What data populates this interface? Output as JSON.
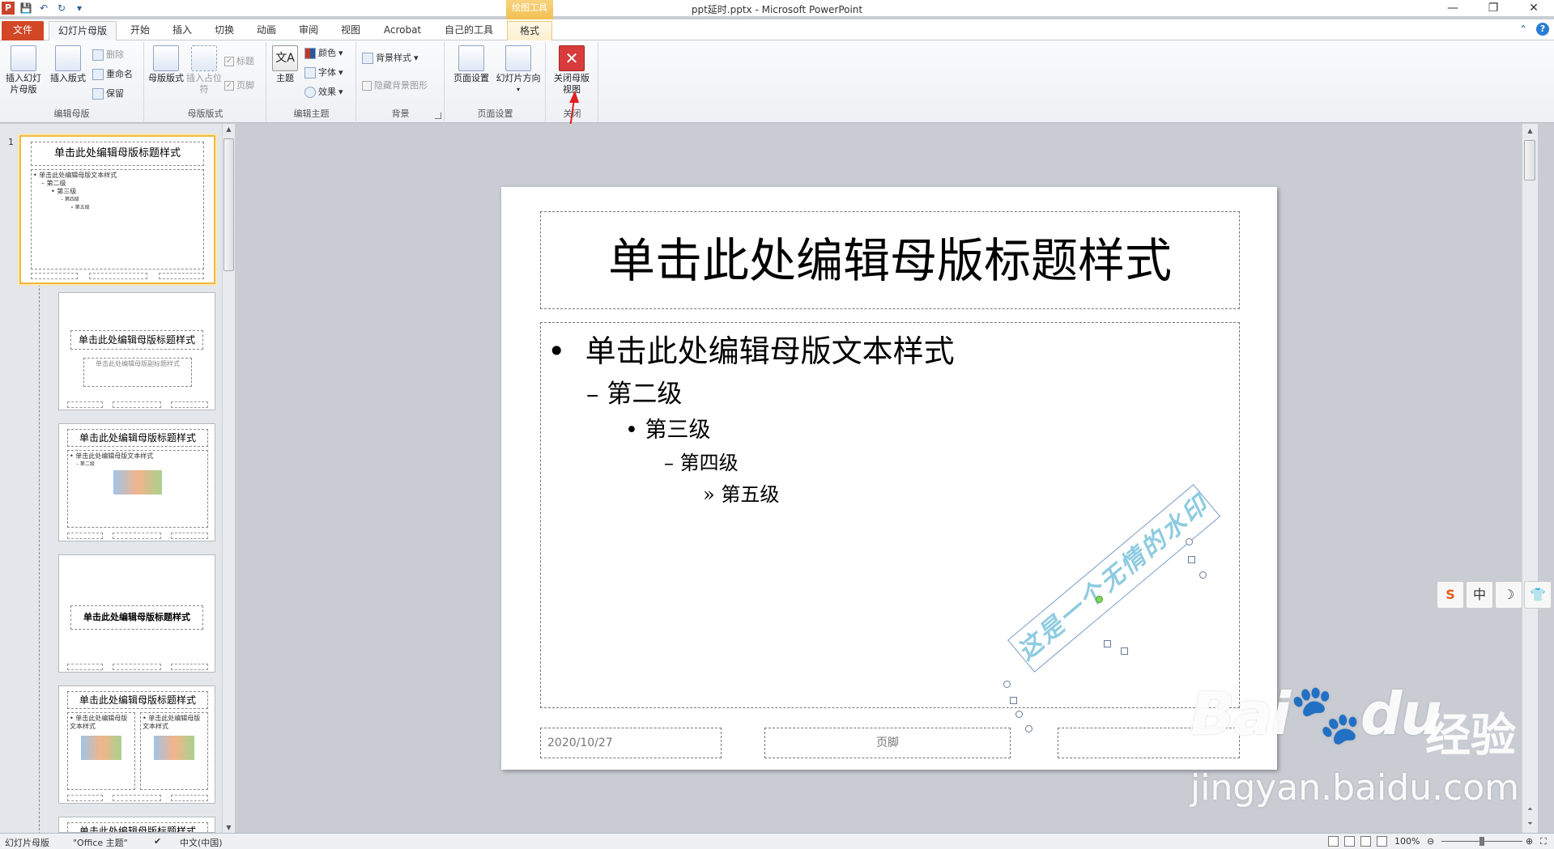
{
  "window": {
    "title": "ppt延时.pptx - Microsoft PowerPoint",
    "app_logo": "P",
    "contextual_group": "绘图工具"
  },
  "tabs": [
    {
      "label": "文件",
      "kind": "file"
    },
    {
      "label": "幻灯片母版",
      "kind": "active"
    },
    {
      "label": "开始"
    },
    {
      "label": "插入"
    },
    {
      "label": "切换"
    },
    {
      "label": "动画"
    },
    {
      "label": "审阅"
    },
    {
      "label": "视图"
    },
    {
      "label": "Acrobat"
    },
    {
      "label": "自己的工具"
    },
    {
      "label": "格式",
      "kind": "ctx"
    }
  ],
  "ribbon": {
    "edit_master": {
      "label": "编辑母版",
      "insert_slide_master": "插入幻灯片母版",
      "insert_layout": "插入版式",
      "delete": "删除",
      "rename": "重命名",
      "preserve": "保留"
    },
    "master_layout": {
      "label": "母版版式",
      "master_layout_btn": "母版版式",
      "insert_placeholder": "插入占位符",
      "title_chk": "标题",
      "footer_chk": "页脚"
    },
    "edit_theme": {
      "label": "编辑主题",
      "themes": "主题",
      "colors": "颜色",
      "fonts": "字体",
      "effects": "效果"
    },
    "background": {
      "label": "背景",
      "bg_styles": "背景样式",
      "hide_bg": "隐藏背景图形"
    },
    "page_setup": {
      "label": "页面设置",
      "page_setup_btn": "页面设置",
      "orientation": "幻灯片方向"
    },
    "close": {
      "label": "关闭",
      "close_master": "关闭母版视图"
    }
  },
  "thumbnails": {
    "first_number": "1",
    "master_title": "单击此处编辑母版标题样式",
    "master_text": "单击此处编辑母版文本样式",
    "lvl2": "第二级",
    "lvl3": "第三级",
    "lvl4": "第四级",
    "lvl5": "第五级",
    "subtitle": "单击此处编辑母版副标题样式"
  },
  "slide": {
    "title": "单击此处编辑母版标题样式",
    "levels": [
      {
        "bullet": "•",
        "text": "单击此处编辑母版文本样式"
      },
      {
        "bullet": "–",
        "text": "第二级"
      },
      {
        "bullet": "•",
        "text": "第三级"
      },
      {
        "bullet": "–",
        "text": "第四级"
      },
      {
        "bullet": "»",
        "text": "第五级"
      }
    ],
    "date": "2020/10/27",
    "footer": "页脚",
    "watermark": "这是一个无情的水印"
  },
  "ime": {
    "logo": "S",
    "mode": "中",
    "moon": "☽",
    "skin": "👕"
  },
  "status": {
    "view_name": "幻灯片母版",
    "theme": "\"Office 主题\"",
    "language": "中文(中国)",
    "zoom": "100%",
    "zoom_level": 0.5
  },
  "overlay": {
    "brand": "Bai",
    "brand2": "du",
    "cn": "经验",
    "url": "jingyan.baidu.com"
  },
  "colors": {
    "file_tab": "#d24726",
    "accent_selection": "#f1b940",
    "annotation_arrow": "#e02020"
  }
}
